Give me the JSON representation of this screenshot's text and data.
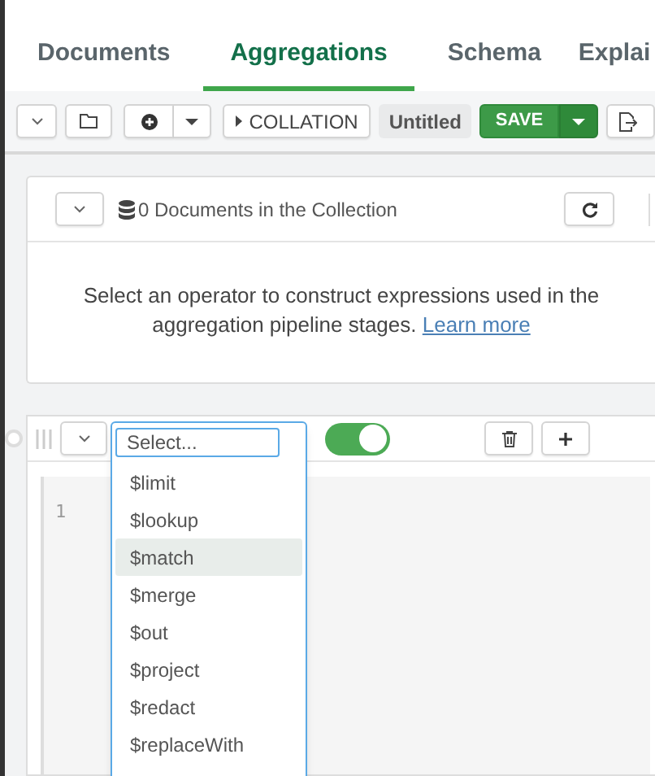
{
  "tabs": [
    {
      "label": "Documents",
      "selected": false
    },
    {
      "label": "Aggregations",
      "selected": true
    },
    {
      "label": "Schema",
      "selected": false
    },
    {
      "label": "Explai",
      "selected": false
    }
  ],
  "toolbar": {
    "collation_button": "COLLATION",
    "pipeline_name": "Untitled",
    "save_button": "SAVE"
  },
  "input_preview": {
    "document_count": "0 Documents in the Collection",
    "message": "Select an operator to construct expressions used in the aggregation pipeline stages.",
    "learn_more_link": "Learn more"
  },
  "stage": {
    "enabled": true,
    "line_numbers": [
      "1"
    ],
    "operator_select": {
      "placeholder": "Select...",
      "options": [
        {
          "label": "$limit",
          "selected": false
        },
        {
          "label": "$lookup",
          "selected": false
        },
        {
          "label": "$match",
          "selected": true
        },
        {
          "label": "$merge",
          "selected": false
        },
        {
          "label": "$out",
          "selected": false
        },
        {
          "label": "$project",
          "selected": false
        },
        {
          "label": "$redact",
          "selected": false
        },
        {
          "label": "$replaceWith",
          "selected": false
        }
      ]
    }
  }
}
